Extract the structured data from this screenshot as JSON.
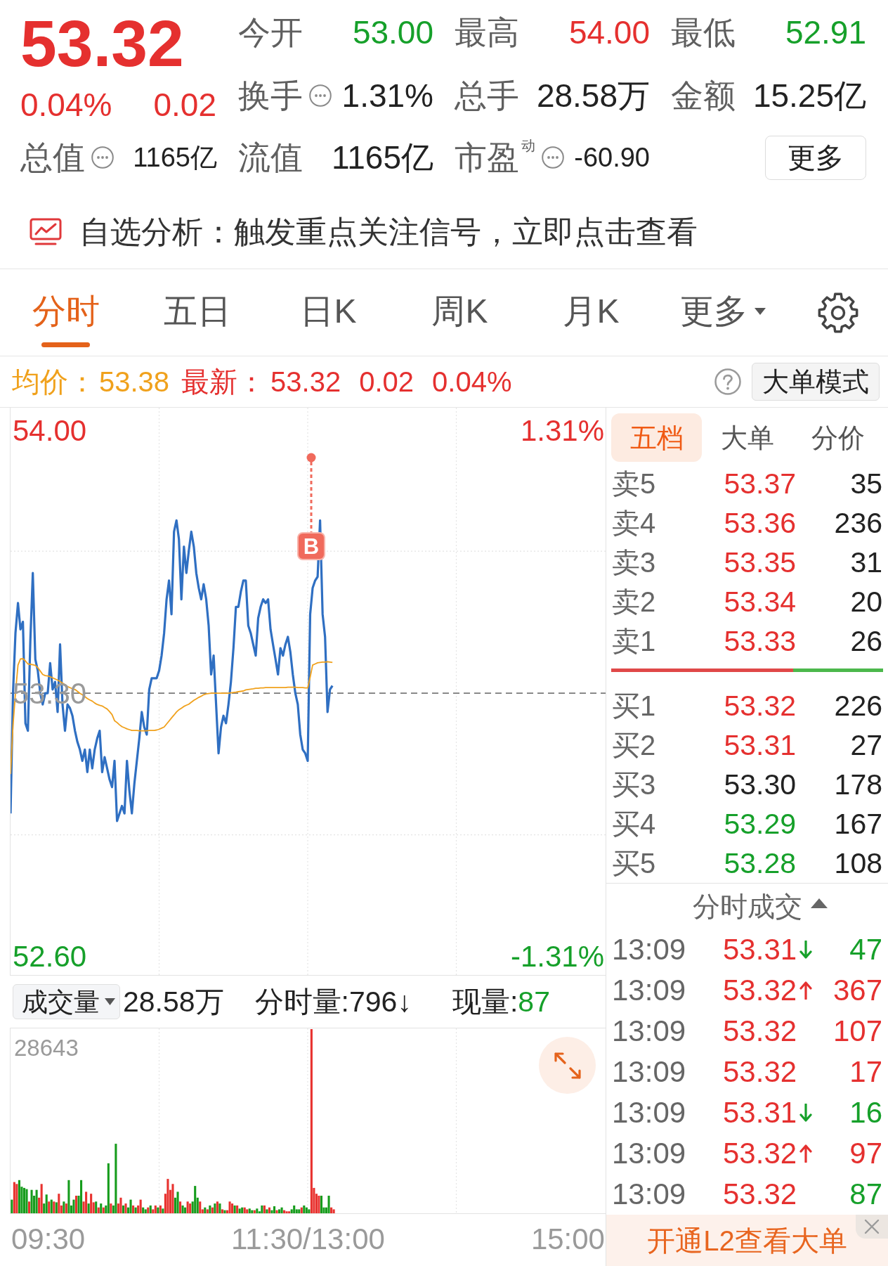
{
  "quote": {
    "price": "53.32",
    "change_percent": "0.04%",
    "change": "0.02",
    "color": "#e5302f"
  },
  "stats": [
    {
      "label": "今开",
      "value": "53.00",
      "color": "#16a02a",
      "info": false
    },
    {
      "label": "最高",
      "value": "54.00",
      "color": "#e5302f",
      "info": false
    },
    {
      "label": "最低",
      "value": "52.91",
      "color": "#16a02a",
      "info": false
    },
    {
      "label": "换手",
      "value": "1.31%",
      "color": "#222222",
      "info": true
    },
    {
      "label": "总手",
      "value": "28.58万",
      "color": "#222222",
      "info": false
    },
    {
      "label": "金额",
      "value": "15.25亿",
      "color": "#222222",
      "info": false
    },
    {
      "label": "总值",
      "value": "1165亿",
      "color": "#222222",
      "info": true
    },
    {
      "label": "流值",
      "value": "1165亿",
      "color": "#222222",
      "info": false
    },
    {
      "label": "市盈$^{动}$",
      "value": "-60.90",
      "color": "#222222",
      "info": true
    }
  ],
  "more_button": "更多",
  "signal": {
    "text": "自选分析：触发重点关注信号，立即点击查看"
  },
  "chart_tabs": [
    {
      "label": "分时",
      "selected": true,
      "dropdown": false
    },
    {
      "label": "五日",
      "selected": false,
      "dropdown": false
    },
    {
      "label": "日K",
      "selected": false,
      "dropdown": false
    },
    {
      "label": "周K",
      "selected": false,
      "dropdown": false
    },
    {
      "label": "月K",
      "selected": false,
      "dropdown": false
    },
    {
      "label": "更多",
      "selected": false,
      "dropdown": true
    }
  ],
  "price_bar": {
    "average_label": "均价：",
    "average_value": "53.38",
    "latest_label": "最新：",
    "latest_price": "53.32",
    "latest_change": "0.02",
    "latest_percent": "0.04%",
    "color": "#e5302f",
    "mode_button": "大单模式"
  },
  "intraday_chart": {
    "percent_labels": [
      {
        "text": "1.31%",
        "color": "#e5302f"
      },
      {
        "text": "-1.31%",
        "color": "#16a02a"
      }
    ],
    "chart_data": {
      "type": "line",
      "categories": [
        null,
        null,
        null,
        null,
        null,
        null,
        null,
        null,
        null,
        null,
        null,
        null,
        null,
        null,
        null,
        null,
        null,
        null,
        null,
        null,
        null,
        null,
        null,
        null,
        null,
        null,
        null,
        null,
        null,
        null,
        null,
        null,
        null,
        null,
        null,
        null,
        null,
        null,
        null,
        null,
        null,
        null,
        null,
        null,
        null,
        null,
        null,
        null,
        null,
        null,
        null,
        null,
        null,
        null,
        null,
        null,
        null,
        null,
        null,
        null,
        null,
        null,
        null,
        null,
        null,
        null,
        null,
        null,
        null,
        null,
        null,
        null,
        null,
        null,
        null,
        null,
        null,
        null,
        null,
        null,
        null,
        null,
        null,
        null,
        null,
        null,
        null,
        null,
        null,
        null,
        null,
        null,
        null,
        null,
        null,
        null,
        null,
        null,
        null,
        null,
        null,
        null,
        null,
        null,
        null,
        null,
        null,
        null,
        null,
        null,
        null,
        null,
        null,
        null,
        null,
        null,
        null,
        null,
        null,
        null,
        null,
        null,
        null,
        null,
        null,
        null,
        null,
        null,
        null,
        null,
        null,
        null,
        null,
        null,
        null,
        null,
        null,
        null,
        null,
        null,
        null,
        null,
        null,
        null,
        null,
        null,
        null,
        null,
        null,
        null,
        null,
        null,
        null,
        null,
        null,
        null,
        null,
        null,
        null,
        null,
        null,
        null,
        null,
        null,
        null,
        null,
        null,
        null,
        null,
        null,
        null,
        null,
        null,
        null,
        null,
        null,
        null,
        null,
        null,
        null,
        null,
        null,
        null,
        null,
        null,
        null,
        null,
        null,
        null,
        null,
        null,
        null,
        null,
        null,
        null,
        null,
        null,
        null,
        null,
        null,
        null,
        null,
        null,
        null,
        null,
        null,
        null,
        null,
        null,
        null,
        null,
        null,
        null,
        null,
        null,
        null,
        null,
        null,
        null,
        null,
        null,
        null,
        null,
        null,
        null,
        null,
        null,
        null,
        null,
        null,
        null,
        null,
        null,
        null,
        null,
        null,
        null,
        null,
        null,
        null,
        null
      ],
      "series": [
        {
          "color": "#2f6fc2",
          "values": [
            52.98,
            53.3,
            53.46,
            53.54,
            53.47,
            53.49,
            53.22,
            53.2,
            53.44,
            53.62,
            53.39,
            53.36,
            53.3,
            53.27,
            53.3,
            53.3,
            53.38,
            53.31,
            53.33,
            53.25,
            53.43,
            53.27,
            53.2,
            53.27,
            53.26,
            53.24,
            53.2,
            53.17,
            53.15,
            53.12,
            53.15,
            53.09,
            53.15,
            53.1,
            53.15,
            53.18,
            53.2,
            53.09,
            53.13,
            53.1,
            53.07,
            53.05,
            53.12,
            52.96,
            52.98,
            53.0,
            52.98,
            53.12,
            53.04,
            52.98,
            53.06,
            53.12,
            53.18,
            53.25,
            53.21,
            53.19,
            53.31,
            53.34,
            53.34,
            53.34,
            53.36,
            53.4,
            53.46,
            53.55,
            53.6,
            53.51,
            53.73,
            53.76,
            53.71,
            53.55,
            53.69,
            53.62,
            53.68,
            53.73,
            53.69,
            53.62,
            53.58,
            53.55,
            53.59,
            53.55,
            53.48,
            53.35,
            53.4,
            53.27,
            53.14,
            53.21,
            53.24,
            53.22,
            53.27,
            53.33,
            53.42,
            53.53,
            53.53,
            53.57,
            53.6,
            53.6,
            53.48,
            53.46,
            53.43,
            53.4,
            53.5,
            53.53,
            53.55,
            53.54,
            53.55,
            53.47,
            53.43,
            53.39,
            53.35,
            53.42,
            53.4,
            53.43,
            53.45,
            53.41,
            53.35,
            53.3,
            53.27,
            53.19,
            53.15,
            53.14,
            53.12,
            53.51,
            53.58,
            53.6,
            53.61,
            53.76,
            53.51,
            53.45,
            53.25,
            53.31,
            53.32,
            null,
            null,
            null,
            null,
            null,
            null,
            null,
            null,
            null,
            null,
            null,
            null,
            null,
            null,
            null,
            null,
            null,
            null,
            null,
            null,
            null,
            null,
            null,
            null,
            null,
            null,
            null,
            null,
            null,
            null,
            null,
            null,
            null,
            null,
            null,
            null,
            null,
            null,
            null,
            null,
            null,
            null,
            null,
            null,
            null,
            null,
            null,
            null,
            null,
            null,
            null,
            null,
            null,
            null,
            null,
            null,
            null,
            null,
            null,
            null,
            null,
            null,
            null,
            null,
            null,
            null,
            null,
            null,
            null,
            null,
            null,
            null,
            null,
            null,
            null,
            null,
            null,
            null,
            null,
            null,
            null,
            null,
            null,
            null,
            null,
            null,
            null,
            null,
            null,
            null,
            null,
            null,
            null,
            null,
            null,
            null,
            null,
            null,
            null,
            null,
            null,
            null,
            null,
            null,
            null,
            null,
            null,
            null,
            null,
            null
          ]
        },
        {
          "color": "#f0a11c",
          "values": [
            53.085,
            53.214,
            53.3,
            53.375,
            53.391,
            53.392,
            53.386,
            53.378,
            53.377,
            53.376,
            53.374,
            53.368,
            53.359,
            53.35,
            53.347,
            53.346,
            53.344,
            53.341,
            53.338,
            53.335,
            53.331,
            53.327,
            53.323,
            53.318,
            53.315,
            53.312,
            53.31,
            53.305,
            53.3,
            53.296,
            53.291,
            53.286,
            53.282,
            53.279,
            53.274,
            53.27,
            53.268,
            53.266,
            53.262,
            53.258,
            53.251,
            53.243,
            53.227,
            53.222,
            53.216,
            53.211,
            53.208,
            53.205,
            53.203,
            53.201,
            53.201,
            53.201,
            53.2,
            53.2,
            53.2,
            53.2,
            53.201,
            53.201,
            53.201,
            53.202,
            53.204,
            53.207,
            53.21,
            53.218,
            53.226,
            53.234,
            53.242,
            53.25,
            53.256,
            53.26,
            53.265,
            53.268,
            53.271,
            53.276,
            53.281,
            53.285,
            53.289,
            53.292,
            53.296,
            53.298,
            53.299,
            53.3,
            53.3,
            53.3,
            53.3,
            53.3,
            53.3,
            53.3,
            53.3,
            53.301,
            53.302,
            53.303,
            53.304,
            53.305,
            53.306,
            53.309,
            53.31,
            53.311,
            53.312,
            53.313,
            53.313,
            53.314,
            53.314,
            53.315,
            53.315,
            53.315,
            53.315,
            53.315,
            53.315,
            53.315,
            53.315,
            53.315,
            53.316,
            53.316,
            53.316,
            53.316,
            53.315,
            53.315,
            53.315,
            53.314,
            53.314,
            53.343,
            53.375,
            53.378,
            53.381,
            53.382,
            53.383,
            53.383,
            53.384,
            53.383,
            53.382,
            null,
            null,
            null,
            null,
            null,
            null,
            null,
            null,
            null,
            null,
            null,
            null,
            null,
            null,
            null,
            null,
            null,
            null,
            null,
            null,
            null,
            null,
            null,
            null,
            null,
            null,
            null,
            null,
            null,
            null,
            null,
            null,
            null,
            null,
            null,
            null,
            null,
            null,
            null,
            null,
            null,
            null,
            null,
            null,
            null,
            null,
            null,
            null,
            null,
            null,
            null,
            null,
            null,
            null,
            null,
            null,
            null,
            null,
            null,
            null,
            null,
            null,
            null,
            null,
            null,
            null,
            null,
            null,
            null,
            null,
            null,
            null,
            null,
            null,
            null,
            null,
            null,
            null,
            null,
            null,
            null,
            null,
            null,
            null,
            null,
            null,
            null,
            null,
            null,
            null,
            null,
            null,
            null,
            null,
            null,
            null,
            null,
            null,
            null,
            null,
            null,
            null,
            null,
            null,
            null,
            null,
            null,
            null,
            null,
            null
          ]
        }
      ],
      "ylim": [
        52.55,
        54.06
      ],
      "yticks": [
        {
          "value": 54.0,
          "label": "54.00"
        },
        {
          "value": 53.3,
          "label": "53.30"
        },
        {
          "value": 52.6,
          "label": "52.60"
        }
      ],
      "ref_lines": [
        {
          "axis": "y",
          "value": 53.3
        }
      ],
      "annotations": [
        "B"
      ]
    }
  },
  "volume_panel": {
    "selector": "成交量",
    "total": "28.58万",
    "minute_volume": "分时量:796↓",
    "current_label": "现量:",
    "current_value": {
      "text": "87",
      "color": "#16a02a"
    },
    "max_label": "28643",
    "time_axis": [
      "09:30",
      "11:30/13:00",
      "15:00"
    ]
  },
  "order_book": {
    "tabs": [
      {
        "label": "五档",
        "selected": true
      },
      {
        "label": "大单",
        "selected": false
      },
      {
        "label": "分价",
        "selected": false
      }
    ],
    "asks": [
      {
        "label": "卖5",
        "price": {
          "text": "53.37",
          "color": "#e5302f"
        },
        "volume": "35"
      },
      {
        "label": "卖4",
        "price": {
          "text": "53.36",
          "color": "#e5302f"
        },
        "volume": "236"
      },
      {
        "label": "卖3",
        "price": {
          "text": "53.35",
          "color": "#e5302f"
        },
        "volume": "31"
      },
      {
        "label": "卖2",
        "price": {
          "text": "53.34",
          "color": "#e5302f"
        },
        "volume": "20"
      },
      {
        "label": "卖1",
        "price": {
          "text": "53.33",
          "color": "#e5302f"
        },
        "volume": "26"
      }
    ],
    "ratio_bar": {
      "level": 0.67
    },
    "bids": [
      {
        "label": "买1",
        "price": {
          "text": "53.32",
          "color": "#e5302f"
        },
        "volume": "226"
      },
      {
        "label": "买2",
        "price": {
          "text": "53.31",
          "color": "#e5302f"
        },
        "volume": "27"
      },
      {
        "label": "买3",
        "price": {
          "text": "53.30",
          "color": "#222222"
        },
        "volume": "178"
      },
      {
        "label": "买4",
        "price": {
          "text": "53.29",
          "color": "#16a02a"
        },
        "volume": "167"
      },
      {
        "label": "买5",
        "price": {
          "text": "53.28",
          "color": "#16a02a"
        },
        "volume": "108"
      }
    ]
  },
  "trades": {
    "title": "分时成交",
    "rows": [
      {
        "time": "13:09",
        "price": {
          "text": "53.31",
          "color": "#e5302f"
        },
        "kind": "down",
        "volume": {
          "text": "47",
          "color": "#16a02a"
        }
      },
      {
        "time": "13:09",
        "price": {
          "text": "53.32",
          "color": "#e5302f"
        },
        "kind": "up",
        "volume": {
          "text": "367",
          "color": "#e5302f"
        }
      },
      {
        "time": "13:09",
        "price": {
          "text": "53.32",
          "color": "#e5302f"
        },
        "kind": "plain",
        "volume": {
          "text": "107",
          "color": "#e5302f"
        }
      },
      {
        "time": "13:09",
        "price": {
          "text": "53.32",
          "color": "#e5302f"
        },
        "kind": "plain",
        "volume": {
          "text": "17",
          "color": "#e5302f"
        }
      },
      {
        "time": "13:09",
        "price": {
          "text": "53.31",
          "color": "#e5302f"
        },
        "kind": "down",
        "volume": {
          "text": "16",
          "color": "#16a02a"
        }
      },
      {
        "time": "13:09",
        "price": {
          "text": "53.32",
          "color": "#e5302f"
        },
        "kind": "up",
        "volume": {
          "text": "97",
          "color": "#e5302f"
        }
      },
      {
        "time": "13:09",
        "price": {
          "text": "53.32",
          "color": "#e5302f"
        },
        "kind": "plain",
        "volume": {
          "text": "87",
          "color": "#16a02a"
        }
      }
    ]
  },
  "promo": {
    "text": "开通L2查看大单"
  }
}
